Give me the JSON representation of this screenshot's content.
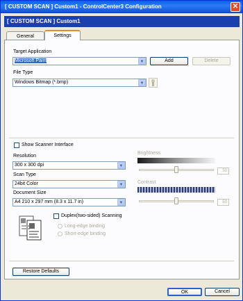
{
  "window": {
    "title": "[ CUSTOM SCAN ]  Custom1 - ControlCenter3 Configuration",
    "header": "[ CUSTOM SCAN ]   Custom1"
  },
  "tabs": [
    {
      "label": "General"
    },
    {
      "label": "Settings"
    }
  ],
  "target": {
    "label": "Target Application",
    "value": "Microsoft Paint",
    "add_label": "Add",
    "delete_label": "Delete"
  },
  "filetype": {
    "label": "File Type",
    "value": "Windows Bitmap (*.bmp)"
  },
  "scanner_interface": {
    "label": "Show Scanner Interface",
    "checked": false
  },
  "resolution": {
    "label": "Resolution",
    "value": "300 x 300 dpi"
  },
  "scan_type": {
    "label": "Scan Type",
    "value": "24bit Color"
  },
  "document_size": {
    "label": "Document Size",
    "value": "A4 210 x 297 mm (8.3 x 11.7 in)"
  },
  "brightness": {
    "label": "Brightness",
    "value": "50",
    "level": 0.5
  },
  "contrast": {
    "label": "Contrast",
    "value": "50",
    "level": 0.5
  },
  "duplex": {
    "label": "Duplex(two-sided) Scanning",
    "checked": false,
    "options": [
      {
        "label": "Long-edge binding"
      },
      {
        "label": "Short-edge binding"
      }
    ]
  },
  "restore_label": "Restore Defaults",
  "ok_label": "OK",
  "cancel_label": "Cancel"
}
